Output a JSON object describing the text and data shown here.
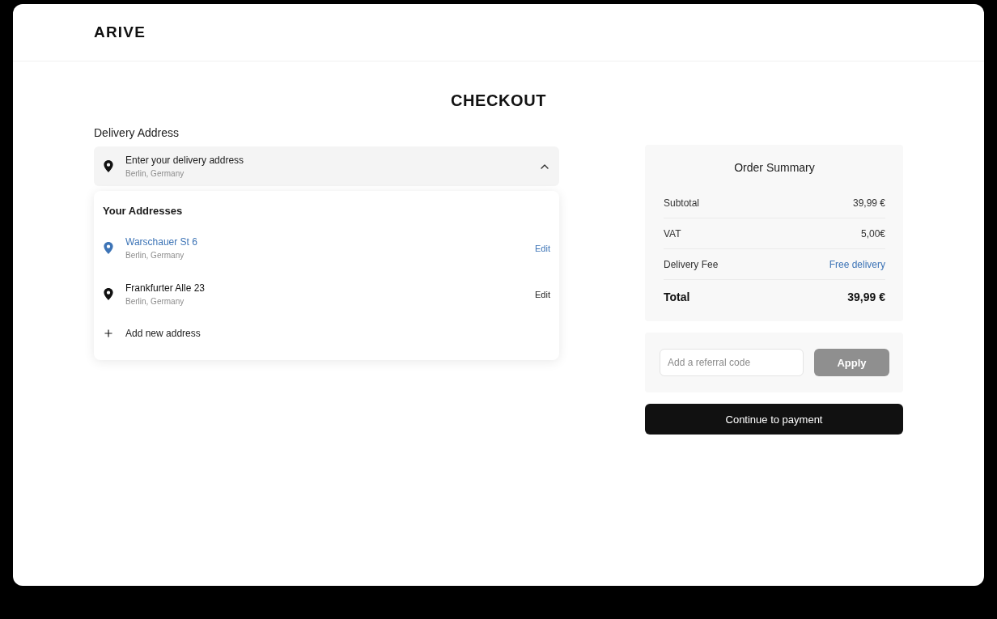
{
  "logo": "ARIVE",
  "page_title": "CHECKOUT",
  "delivery": {
    "label": "Delivery Address",
    "field": {
      "title": "Enter your delivery address",
      "subtitle": "Berlin, Germany",
      "expanded": true
    },
    "dropdown": {
      "heading": "Your Addresses",
      "addresses": [
        {
          "street": "Warschauer St 6",
          "city": "Berlin, Germany",
          "action": "Edit",
          "selected": true
        },
        {
          "street": "Frankfurter Alle 23",
          "city": "Berlin, Germany",
          "action": "Edit",
          "selected": false
        }
      ],
      "add_action": "Add new address"
    }
  },
  "order_summary": {
    "title": "Order Summary",
    "rows": [
      {
        "label": "Subtotal",
        "value": "39,99 €",
        "kind": "amount"
      },
      {
        "label": "VAT",
        "value": "5,00€",
        "kind": "amount"
      },
      {
        "label": "Delivery Fee",
        "value": "Free delivery",
        "kind": "offer"
      },
      {
        "label": "Total",
        "value": "39,99 €",
        "kind": "total"
      }
    ]
  },
  "referral": {
    "placeholder": "Add a referral code",
    "apply_button": {
      "label": "Apply",
      "disabled": true
    }
  },
  "continue_button": "Continue to payment"
}
